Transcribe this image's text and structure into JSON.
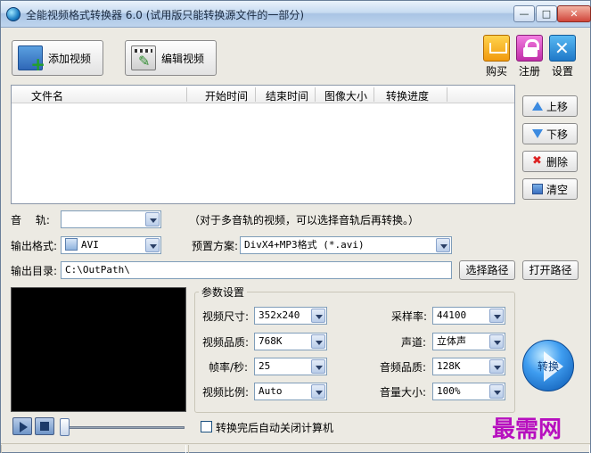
{
  "window": {
    "title": "全能视频格式转换器 6.0 (试用版只能转换源文件的一部分)",
    "controls": {
      "minimize": "—",
      "maximize": "□",
      "close": "✕"
    }
  },
  "toolbar": {
    "add_video_label": "添加视频",
    "edit_video_label": "编辑视频",
    "buy_label": "购买",
    "register_label": "注册",
    "settings_label": "设置"
  },
  "file_list": {
    "columns": [
      "文件名",
      "开始时间",
      "结束时间",
      "图像大小",
      "转换进度"
    ],
    "rows": []
  },
  "side_buttons": {
    "move_up": "上移",
    "move_down": "下移",
    "delete": "删除",
    "clear": "清空"
  },
  "audio_track": {
    "label": "音　 轨:",
    "value": "",
    "hint": "（对于多音轨的视频，可以选择音轨后再转换。）"
  },
  "output_format": {
    "label": "输出格式:",
    "value": "AVI"
  },
  "preset": {
    "label": "预置方案:",
    "value": "DivX4+MP3格式 (*.avi)"
  },
  "output_dir": {
    "label": "输出目录:",
    "value": "C:\\OutPath\\",
    "choose_button": "选择路径",
    "open_button": "打开路径"
  },
  "params": {
    "title": "参数设置",
    "video_size": {
      "label": "视频尺寸:",
      "value": "352x240"
    },
    "video_quality": {
      "label": "视频品质:",
      "value": "768K"
    },
    "frame_rate": {
      "label": "帧率/秒:",
      "value": "25"
    },
    "aspect_ratio": {
      "label": "视频比例:",
      "value": "Auto"
    },
    "sample_rate": {
      "label": "采样率:",
      "value": "44100"
    },
    "channels": {
      "label": "声道:",
      "value": "立体声"
    },
    "audio_quality": {
      "label": "音频品质:",
      "value": "128K"
    },
    "volume": {
      "label": "音量大小:",
      "value": "100%"
    }
  },
  "convert_button": "转换",
  "shutdown_checkbox": {
    "label": "转换完后自动关闭计算机",
    "checked": false
  },
  "playback": {
    "seek_position": 0
  },
  "watermark": "最需网"
}
